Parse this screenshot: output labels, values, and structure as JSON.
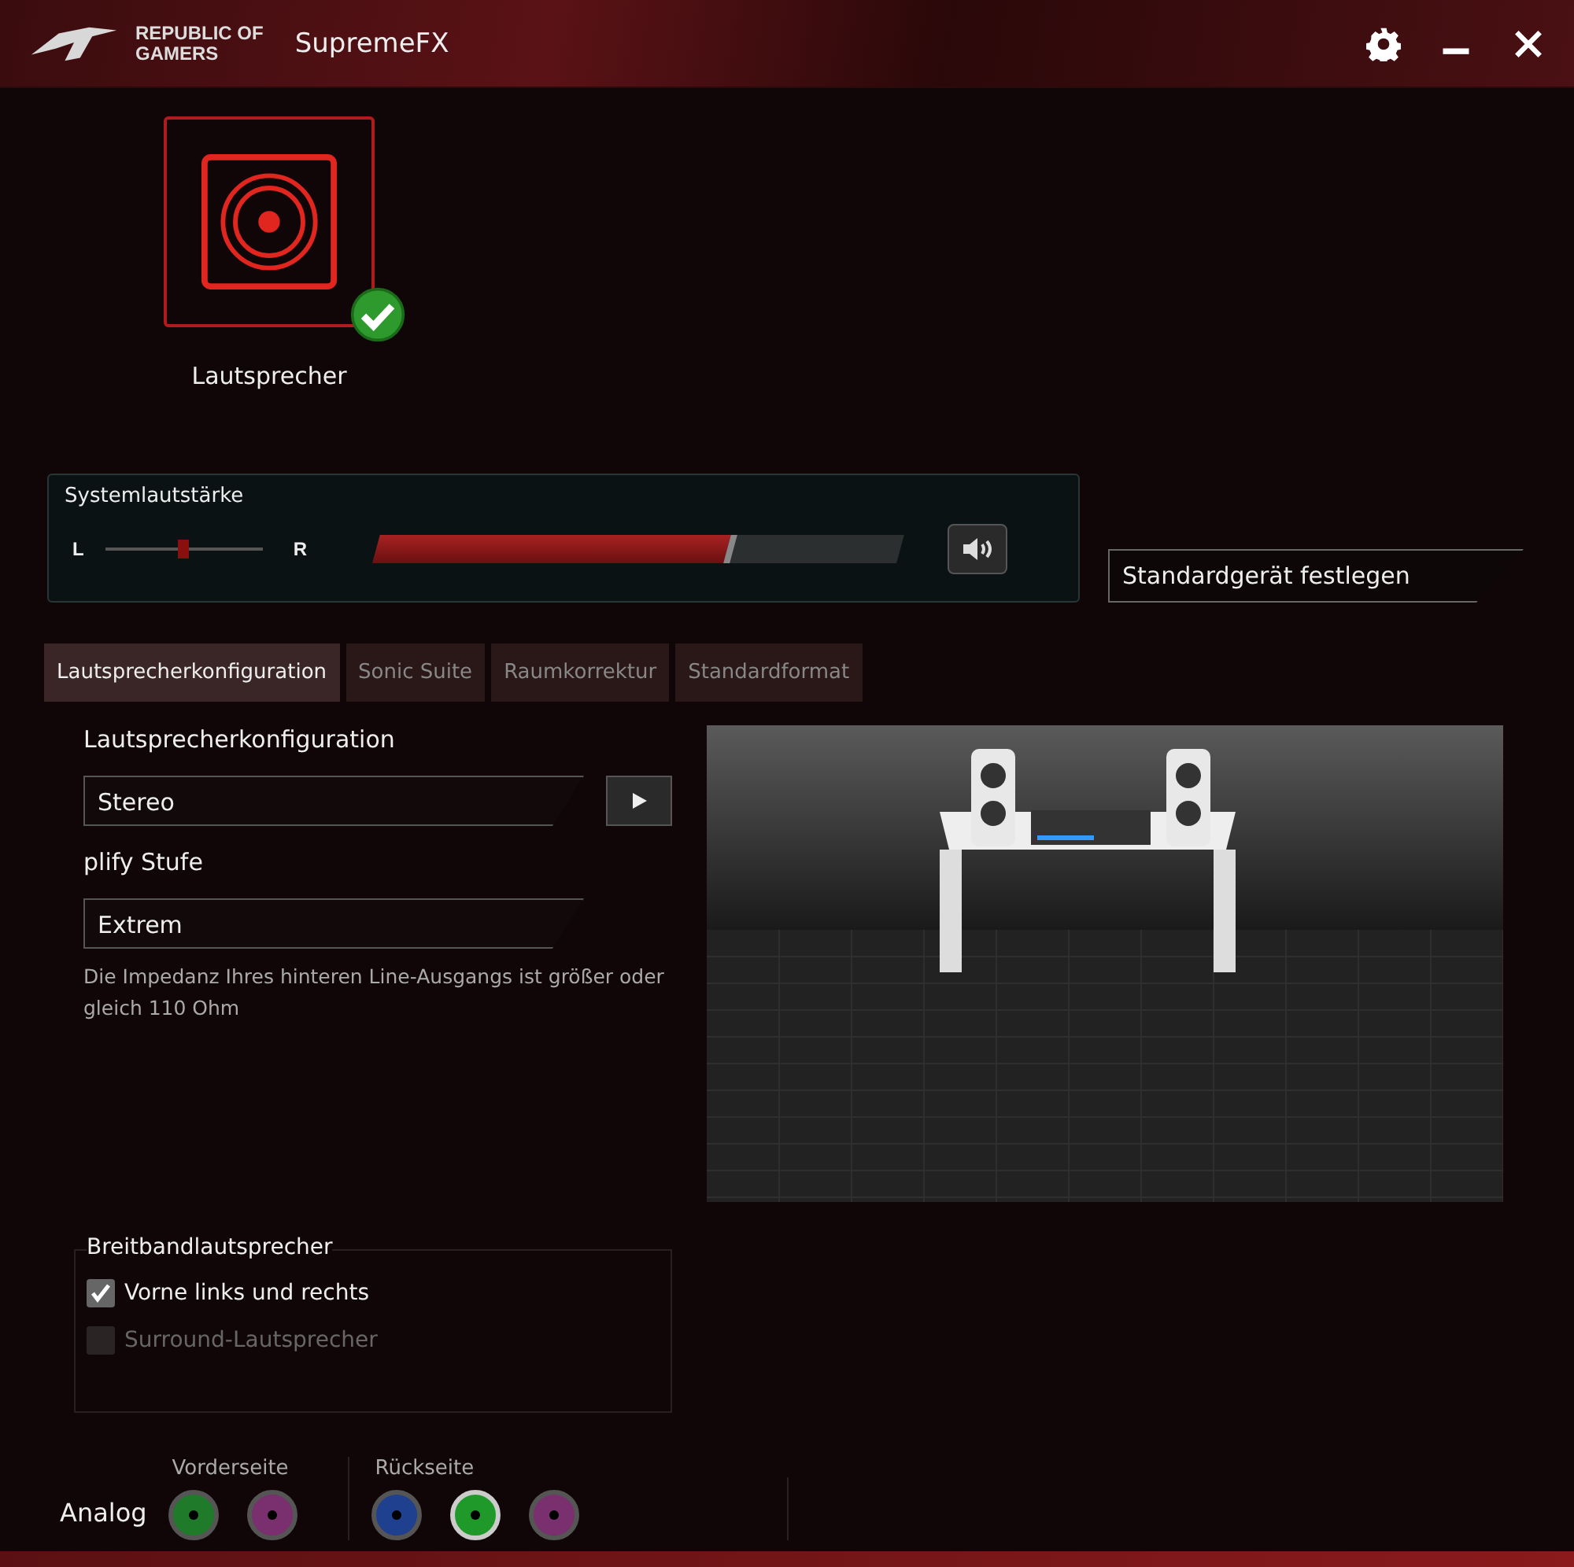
{
  "window": {
    "logo_lines": [
      "REPUBLIC OF",
      "GAMERS"
    ],
    "title": "SupremeFX"
  },
  "devices": [
    {
      "label": "Lautsprecher",
      "selected": true,
      "ready": true
    }
  ],
  "volume": {
    "title": "Systemlautstärke",
    "left": "L",
    "right": "R",
    "balance": {
      "level": 0.5
    },
    "master": {
      "level": 0.67
    },
    "muted": false
  },
  "default_device": {
    "value": "Standardgerät festlegen"
  },
  "tabs": [
    {
      "label": "Lautsprecherkonfiguration",
      "selected": true
    },
    {
      "label": "Sonic Suite",
      "selected": false
    },
    {
      "label": "Raumkorrektur",
      "selected": false
    },
    {
      "label": "Standardformat",
      "selected": false
    }
  ],
  "config": {
    "label": "Lautsprecherkonfiguration",
    "value": "Stereo"
  },
  "amp": {
    "label": "plify Stufe",
    "value": "Extrem",
    "note": "Die Impedanz Ihres hinteren Line-Ausgangs ist größer oder gleich 110 Ohm"
  },
  "fullrange": {
    "title": "Breitbandlautsprecher",
    "options": [
      {
        "label": "Vorne links und rechts",
        "checked": true,
        "disabled": false
      },
      {
        "label": "Surround-Lautsprecher",
        "checked": false,
        "disabled": true
      }
    ]
  },
  "jacks": {
    "label": "Analog",
    "groups": [
      {
        "title": "Vorderseite",
        "items": [
          {
            "color": "#1f7a2a",
            "active": false
          },
          {
            "color": "#7a2f6e",
            "active": false
          }
        ]
      },
      {
        "title": "Rückseite",
        "items": [
          {
            "color": "#1f3f8f",
            "active": false
          },
          {
            "color": "#1f9a2a",
            "active": true
          },
          {
            "color": "#7a2f6e",
            "active": false
          }
        ]
      }
    ]
  }
}
